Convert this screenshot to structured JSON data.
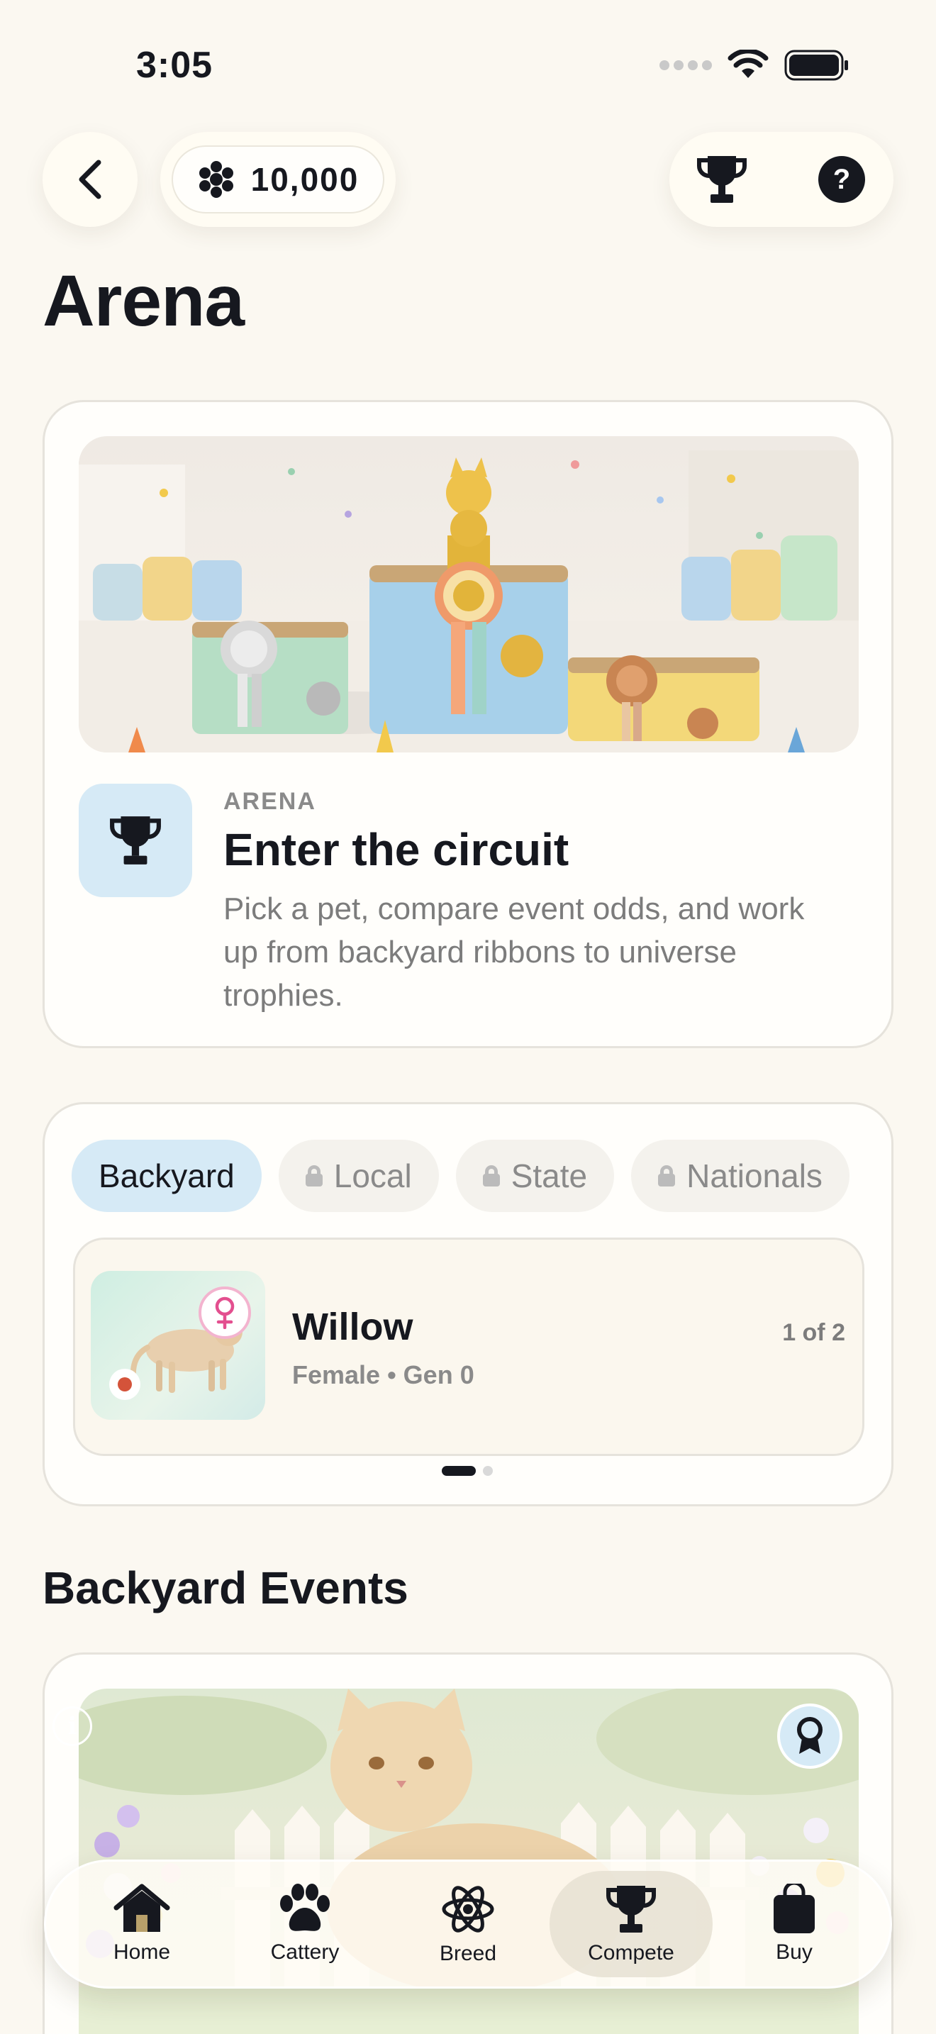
{
  "status_bar": {
    "time": "3:05"
  },
  "top_bar": {
    "coins": "10,000"
  },
  "page": {
    "title": "Arena"
  },
  "hero": {
    "eyebrow": "ARENA",
    "title": "Enter the circuit",
    "description": "Pick a pet, compare event odds, and work up from backyard ribbons to universe trophies."
  },
  "picker": {
    "tabs": [
      {
        "label": "Backyard",
        "locked": false,
        "active": true
      },
      {
        "label": "Local",
        "locked": true
      },
      {
        "label": "State",
        "locked": true
      },
      {
        "label": "Nationals",
        "locked": true
      }
    ],
    "pet": {
      "name": "Willow",
      "meta": "Female • Gen 0",
      "count": "1 of 2"
    },
    "page_index": 0,
    "page_count": 2
  },
  "events": {
    "section_title": "Backyard Events"
  },
  "tabbar": {
    "items": [
      {
        "label": "Home",
        "icon": "home-icon"
      },
      {
        "label": "Cattery",
        "icon": "paw-icon"
      },
      {
        "label": "Breed",
        "icon": "atom-icon"
      },
      {
        "label": "Compete",
        "icon": "trophy-icon",
        "active": true
      },
      {
        "label": "Buy",
        "icon": "bag-icon"
      }
    ]
  },
  "colors": {
    "accent": "#d6eaf6",
    "ink": "#16181f",
    "background": "#fbf8f1"
  }
}
